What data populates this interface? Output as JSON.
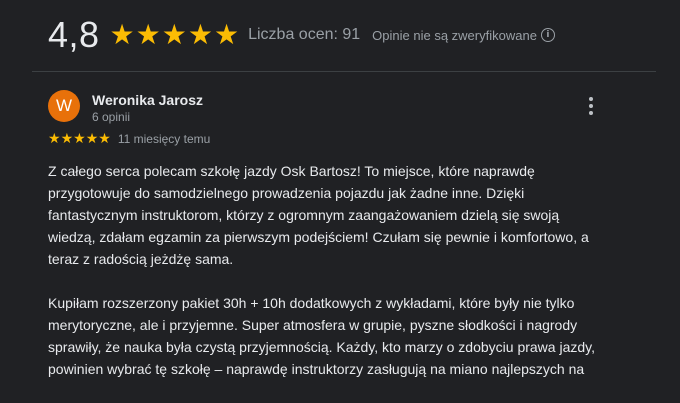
{
  "summary": {
    "rating": "4,8",
    "star_count": 5,
    "rating_count_label": "Liczba ocen: 91",
    "unverified_label": "Opinie nie są zweryfikowane",
    "info_icon": "info-icon"
  },
  "review": {
    "avatar_letter": "W",
    "avatar_color": "#e8710a",
    "reviewer_name": "Weronika Jarosz",
    "reviewer_meta": "6 opinii",
    "stars": 5,
    "time_ago": "11 miesięcy temu",
    "more_icon": "more-vert-icon",
    "paragraphs": [
      "Z całego serca polecam szkołę jazdy Osk Bartosz! To miejsce, które naprawdę przygotowuje do samodzielnego prowadzenia pojazdu jak żadne inne. Dzięki fantastycznym instruktorom, którzy z ogromnym zaangażowaniem dzielą się swoją wiedzą, zdałam egzamin za pierwszym podejściem! Czułam się pewnie i komfortowo, a teraz z radością jeżdżę sama.",
      "Kupiłam rozszerzony pakiet 30h + 10h dodatkowych z wykładami, które były nie tylko merytoryczne, ale i przyjemne. Super atmosfera w grupie, pyszne słodkości i nagrody sprawiły, że nauka była czystą przyjemnością. Każdy, kto marzy o zdobyciu prawa jazdy, powinien wybrać tę szkołę – naprawdę instruktorzy zasługują na miano najlepszych na"
    ]
  },
  "colors": {
    "background": "#202124",
    "star": "#fbbc04",
    "primary_text": "#e8eaed",
    "secondary_text": "#9aa0a6"
  }
}
